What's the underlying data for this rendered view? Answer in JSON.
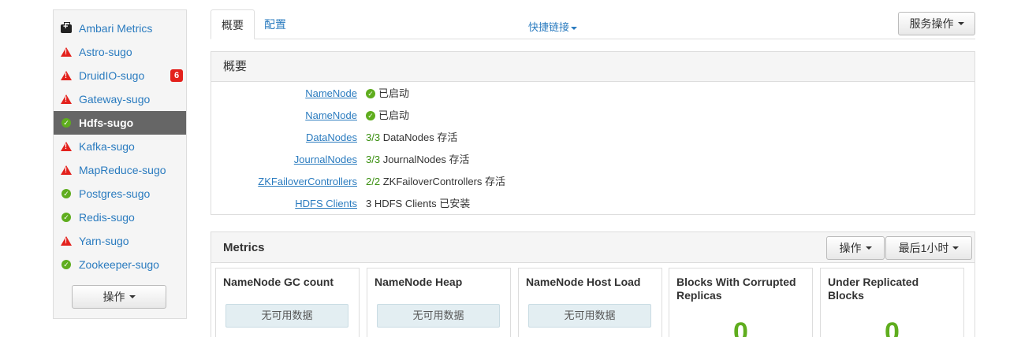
{
  "sidebar": {
    "services": [
      {
        "label": "Ambari Metrics",
        "status": "maintenance",
        "icon": "toolbox-icon"
      },
      {
        "label": "Astro-sugo",
        "status": "alert",
        "icon": "warning-icon"
      },
      {
        "label": "DruidIO-sugo",
        "status": "alert",
        "icon": "warning-icon",
        "badge": "6"
      },
      {
        "label": "Gateway-sugo",
        "status": "alert",
        "icon": "warning-icon"
      },
      {
        "label": "Hdfs-sugo",
        "status": "ok",
        "icon": "check-icon",
        "active": true
      },
      {
        "label": "Kafka-sugo",
        "status": "alert",
        "icon": "warning-icon"
      },
      {
        "label": "MapReduce-sugo",
        "status": "alert",
        "icon": "warning-icon"
      },
      {
        "label": "Postgres-sugo",
        "status": "ok",
        "icon": "check-icon"
      },
      {
        "label": "Redis-sugo",
        "status": "ok",
        "icon": "check-icon"
      },
      {
        "label": "Yarn-sugo",
        "status": "alert",
        "icon": "warning-icon"
      },
      {
        "label": "Zookeeper-sugo",
        "status": "ok",
        "icon": "check-icon"
      }
    ],
    "actions_label": "操作"
  },
  "tabs": {
    "summary": "概要",
    "configs": "配置",
    "quick_links": "快捷链接",
    "service_actions": "服务操作"
  },
  "summary_panel": {
    "title": "概要",
    "components": [
      {
        "name": "NameNode",
        "count": "",
        "value": "已启动",
        "ok_icon": true
      },
      {
        "name": "NameNode",
        "count": "",
        "value": "已启动",
        "ok_icon": true
      },
      {
        "name": "DataNodes",
        "count": "3/3",
        "value": "DataNodes 存活",
        "ok_icon": false
      },
      {
        "name": "JournalNodes",
        "count": "3/3",
        "value": "JournalNodes 存活",
        "ok_icon": false
      },
      {
        "name": "ZKFailoverControllers",
        "count": "2/2",
        "value": "ZKFailoverControllers 存活",
        "ok_icon": false
      },
      {
        "name": "HDFS Clients",
        "count": "",
        "value": "3 HDFS Clients 已安装",
        "ok_icon": false
      }
    ]
  },
  "metrics_panel": {
    "title": "Metrics",
    "actions_label": "操作",
    "range_label": "最后1小时",
    "widgets": [
      {
        "title": "NameNode GC count",
        "nodata": "无可用数据",
        "value": ""
      },
      {
        "title": "NameNode Heap",
        "nodata": "无可用数据",
        "value": ""
      },
      {
        "title": "NameNode Host Load",
        "nodata": "无可用数据",
        "value": ""
      },
      {
        "title": "Blocks With Corrupted Replicas",
        "nodata": "",
        "value": "0"
      },
      {
        "title": "Under Replicated Blocks",
        "nodata": "",
        "value": "0"
      }
    ]
  },
  "colors": {
    "link": "#2a7bbf",
    "ok": "#5fad1e",
    "alert": "#e3211c",
    "active_bg": "#666666"
  }
}
